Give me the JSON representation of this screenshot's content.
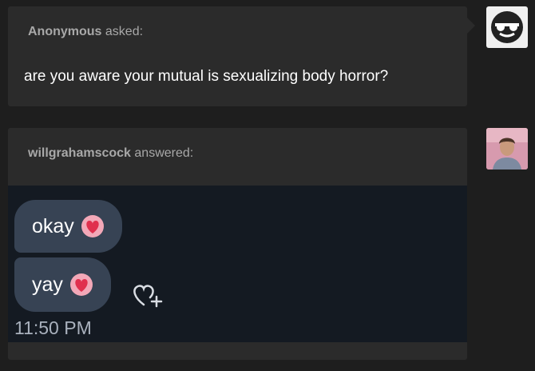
{
  "ask": {
    "asker": "Anonymous",
    "asked_suffix": "asked:",
    "question": "are you aware your mutual is sexualizing body horror?"
  },
  "answer": {
    "answerer": "willgrahamscock",
    "answered_suffix": "answered:",
    "screenshot": {
      "messages": [
        {
          "text": "okay",
          "emoji": "heart-emoji"
        },
        {
          "text": "yay",
          "emoji": "heart-emoji"
        }
      ],
      "timestamp": "11:50 PM"
    }
  },
  "avatars": {
    "anon_icon": "sunglasses-anon-icon",
    "user_icon": "user-photo-avatar"
  },
  "colors": {
    "background": "#1e1e1e",
    "card": "#2b2b2b",
    "muted_text": "#a8a8a8",
    "bubble": "#374354",
    "chat_background": "#141a22"
  }
}
